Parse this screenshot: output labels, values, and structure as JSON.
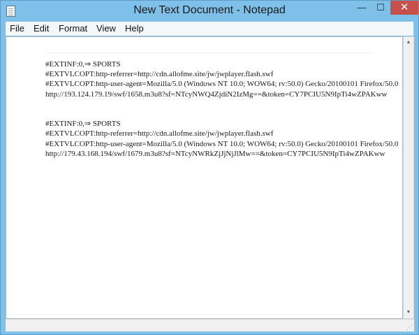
{
  "window": {
    "title": "New Text Document - Notepad",
    "icon": "notepad-icon",
    "controls": {
      "minimize": "—",
      "maximize": "☐",
      "close": "✕"
    }
  },
  "menu": {
    "file": "File",
    "edit": "Edit",
    "format": "Format",
    "view": "View",
    "help": "Help"
  },
  "editor": {
    "content": "#EXTINF:0,⇒ SPORTS\n#EXTVLCOPT:http-referrer=http://cdn.allofme.site/jw/jwplayer.flash.swf\n#EXTVLCOPT:http-user-agent=Mozilla/5.0 (Windows NT 10.0; WOW64; rv:50.0) Gecko/20100101 Firefox/50.0\nhttp://193.124.179.19/swf/1658.m3u8?sf=NTcyNWQ4ZjdiN2IzMg==&token=CY7PCIU5N9IpTi4wZPAKww\n\n\n#EXTINF:0,⇒ SPORTS\n#EXTVLCOPT:http-referrer=http://cdn.allofme.site/jw/jwplayer.flash.swf\n#EXTVLCOPT:http-user-agent=Mozilla/5.0 (Windows NT 10.0; WOW64; rv:50.0) Gecko/20100101 Firefox/50.0\nhttp://179.43.168.194/swf/1679.m3u8?sf=NTcyNWRkZjJjNjJlMw==&token=CY7PCIU5N9IpTi4wZPAKww"
  },
  "scrollbar": {
    "up": "▲",
    "down": "▼"
  },
  "statusbar": {
    "grip": "⋰"
  }
}
